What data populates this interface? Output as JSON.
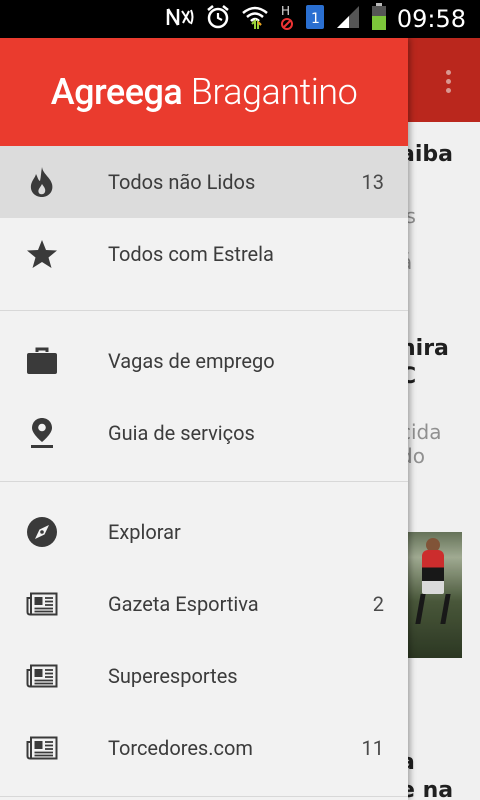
{
  "status_bar": {
    "time": "09:58",
    "icons": [
      "nfc-icon",
      "alarm-icon",
      "wifi-icon",
      "h-signal-icon",
      "sim-1-icon",
      "cell-signal-icon",
      "battery-icon"
    ],
    "sim_label": "1",
    "network_label": "H"
  },
  "background": {
    "toolbar_color": "#c62a1f",
    "snippets": [
      "aiba",
      "is",
      "á",
      "nira",
      "C",
      "cida",
      "do",
      "a",
      "e na"
    ]
  },
  "drawer": {
    "header": {
      "title_bold": "Agreega",
      "title_light": "Bragantino",
      "color": "#ea3b2e"
    },
    "sections": [
      {
        "items": [
          {
            "label": "Todos não Lidos",
            "count": "13",
            "icon": "fire-icon",
            "active": true
          },
          {
            "label": "Todos com Estrela",
            "count": "",
            "icon": "star-icon",
            "active": false
          }
        ]
      },
      {
        "items": [
          {
            "label": "Vagas de emprego",
            "count": "",
            "icon": "briefcase-icon",
            "active": false
          },
          {
            "label": "Guia de serviços",
            "count": "",
            "icon": "location-pin-icon",
            "active": false
          }
        ]
      },
      {
        "items": [
          {
            "label": "Explorar",
            "count": "",
            "icon": "compass-icon",
            "active": false
          },
          {
            "label": "Gazeta Esportiva",
            "count": "2",
            "icon": "newspaper-icon",
            "active": false
          },
          {
            "label": "Superesportes",
            "count": "",
            "icon": "newspaper-icon",
            "active": false
          },
          {
            "label": "Torcedores.com",
            "count": "11",
            "icon": "newspaper-icon",
            "active": false
          }
        ]
      }
    ]
  }
}
